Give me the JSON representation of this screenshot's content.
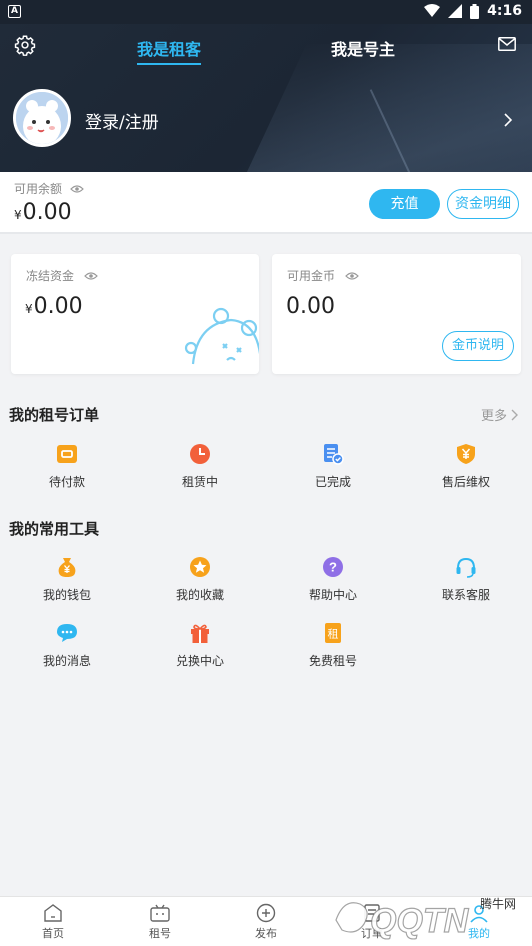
{
  "status_bar": {
    "time": "4:16"
  },
  "header": {
    "tabs": [
      {
        "label": "我是租客",
        "active": true
      },
      {
        "label": "我是号主",
        "active": false
      }
    ],
    "login_label": "登录/注册"
  },
  "balance": {
    "label": "可用余额",
    "currency": "¥",
    "amount": "0.00",
    "recharge_label": "充值",
    "detail_label": "资金明细"
  },
  "cards": {
    "frozen": {
      "label": "冻结资金",
      "currency": "¥",
      "amount": "0.00"
    },
    "coins": {
      "label": "可用金币",
      "amount": "0.00",
      "button_label": "金币说明"
    }
  },
  "orders": {
    "title": "我的租号订单",
    "more_label": "更多",
    "items": [
      {
        "label": "待付款",
        "icon": "wallet-pending-icon"
      },
      {
        "label": "租赁中",
        "icon": "clock-icon"
      },
      {
        "label": "已完成",
        "icon": "completed-document-icon"
      },
      {
        "label": "售后维权",
        "icon": "shield-yen-icon"
      }
    ]
  },
  "tools": {
    "title": "我的常用工具",
    "items": [
      {
        "label": "我的钱包",
        "icon": "money-bag-icon"
      },
      {
        "label": "我的收藏",
        "icon": "star-icon"
      },
      {
        "label": "帮助中心",
        "icon": "question-icon"
      },
      {
        "label": "联系客服",
        "icon": "headset-icon"
      },
      {
        "label": "我的消息",
        "icon": "message-icon"
      },
      {
        "label": "兑换中心",
        "icon": "gift-icon"
      },
      {
        "label": "免费租号",
        "icon": "free-rent-icon"
      }
    ]
  },
  "bottom_nav": {
    "items": [
      {
        "label": "首页"
      },
      {
        "label": "租号"
      },
      {
        "label": "发布"
      },
      {
        "label": "订单"
      },
      {
        "label": "我的"
      }
    ]
  },
  "watermark": {
    "text": "QQTN",
    "site": "腾牛网"
  },
  "colors": {
    "accent": "#2fb7f0",
    "header_bg": "#1f2a38",
    "orange": "#f7a21b",
    "red": "#f2603a",
    "purple": "#8f6fe6"
  }
}
